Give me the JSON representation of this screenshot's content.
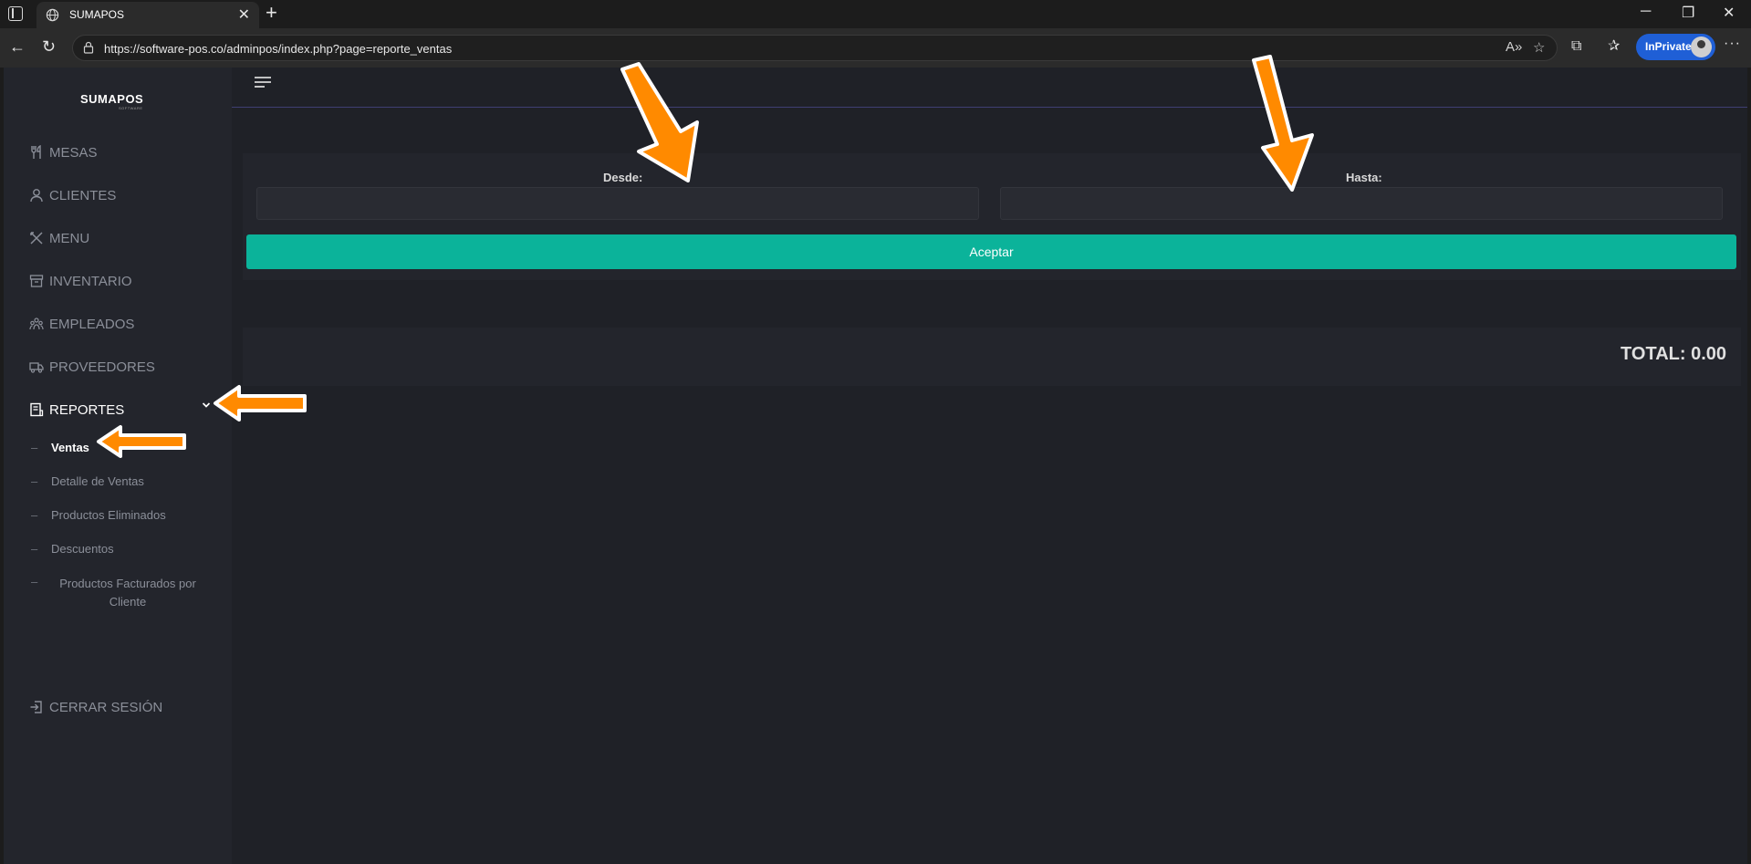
{
  "browser": {
    "tab_title": "SUMAPOS",
    "url": "https://software-pos.co/adminpos/index.php?page=reporte_ventas",
    "inprivate_label": "InPrivate"
  },
  "sidebar": {
    "logo": "SUMAPOS",
    "logo_sub": "SOFTWARE",
    "items": [
      {
        "label": "MESAS",
        "icon": "utensils-icon"
      },
      {
        "label": "CLIENTES",
        "icon": "user-icon"
      },
      {
        "label": "MENU",
        "icon": "tools-icon"
      },
      {
        "label": "INVENTARIO",
        "icon": "archive-icon"
      },
      {
        "label": "EMPLEADOS",
        "icon": "people-icon"
      },
      {
        "label": "PROVEEDORES",
        "icon": "truck-icon"
      },
      {
        "label": "REPORTES",
        "icon": "report-icon"
      }
    ],
    "subitems": [
      {
        "label": "Ventas"
      },
      {
        "label": "Detalle de Ventas"
      },
      {
        "label": "Productos Eliminados"
      },
      {
        "label": "Descuentos"
      },
      {
        "label": "Productos Facturados por Cliente"
      }
    ],
    "logout": {
      "label": "CERRAR SESIÓN",
      "icon": "logout-icon"
    }
  },
  "filter": {
    "from_label": "Desde:",
    "to_label": "Hasta:",
    "from_value": "",
    "to_value": "",
    "accept_label": "Aceptar"
  },
  "summary": {
    "total_label": "TOTAL: 0.00"
  },
  "colors": {
    "accent": "#0bb39a",
    "sidebar_bg": "#23252c",
    "page_bg": "#1f2127",
    "callout_arrow": "#ff8a00"
  }
}
